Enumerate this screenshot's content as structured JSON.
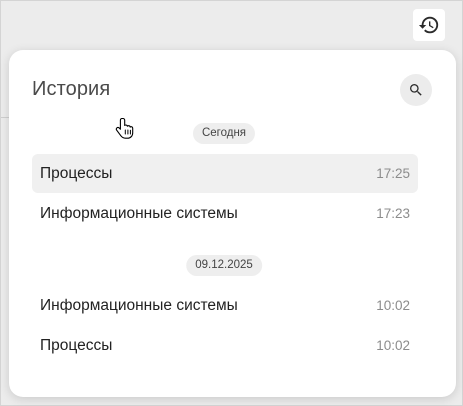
{
  "header": {
    "history_button_icon": "history-icon"
  },
  "popover": {
    "title": "История",
    "search_icon": "search-icon",
    "groups": [
      {
        "date_label": "Сегодня",
        "items": [
          {
            "label": "Процессы",
            "time": "17:25",
            "hovered": true
          },
          {
            "label": "Информационные системы",
            "time": "17:23",
            "hovered": false
          }
        ]
      },
      {
        "date_label": "09.12.2025",
        "items": [
          {
            "label": "Информационные системы",
            "time": "10:02",
            "hovered": false
          },
          {
            "label": "Процессы",
            "time": "10:02",
            "hovered": false
          }
        ]
      }
    ]
  },
  "colors": {
    "backdrop": "#ececec",
    "popover_bg": "#ffffff",
    "hover_bg": "#f0f0f0",
    "chip_bg": "#eeeeee",
    "text_primary": "#222222",
    "text_muted": "#8c8c8c"
  }
}
